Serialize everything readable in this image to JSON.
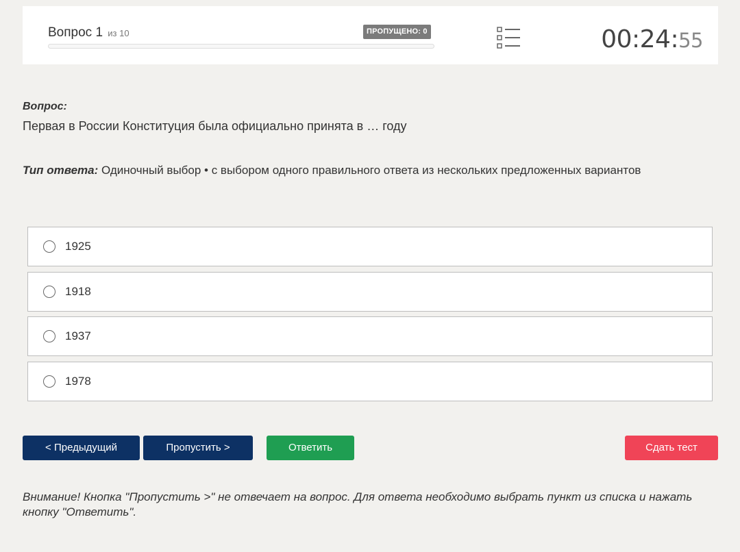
{
  "header": {
    "question_label": "Вопрос 1",
    "question_of": "из 10",
    "skipped_badge": "ПРОПУЩЕНО: 0",
    "progress_fraction": 0,
    "timer_main": "00:24:",
    "timer_seconds": "55"
  },
  "question": {
    "label": "Вопрос:",
    "text": "Первая в России Конституция была официально принята в … году"
  },
  "answer_type": {
    "label": "Тип ответа:",
    "value": "Одиночный выбор • с выбором одного правильного ответа из нескольких предложенных вариантов"
  },
  "options": [
    "1925",
    "1918",
    "1937",
    "1978"
  ],
  "buttons": {
    "prev": "< Предыдущий",
    "skip": "Пропустить >",
    "answer": "Ответить",
    "finish": "Сдать тест"
  },
  "warning": "Внимание! Кнопка \"Пропустить >\" не отвечает на вопрос. Для ответа необходимо выбрать пункт из списка и нажать кнопку \"Ответить\".",
  "colors": {
    "navy": "#0d3164",
    "green": "#1f9e52",
    "red": "#f04457",
    "badge_gray": "#7b7b7b"
  }
}
